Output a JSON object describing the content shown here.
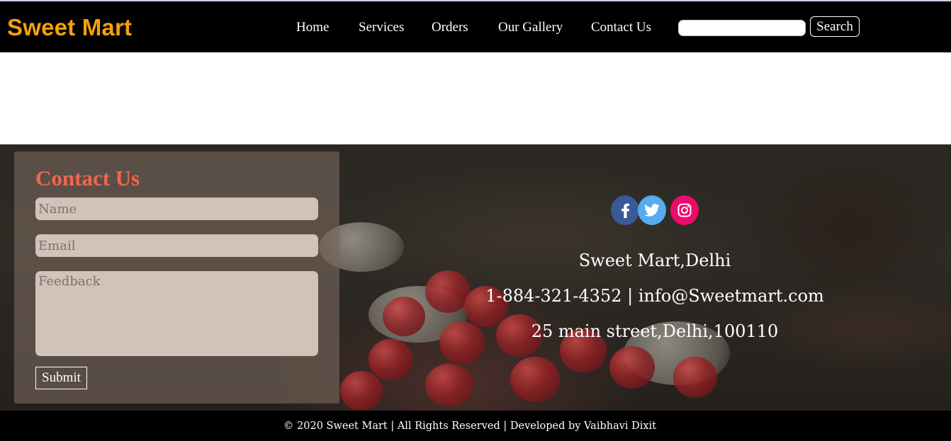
{
  "header": {
    "brand": "Sweet Mart",
    "nav": [
      {
        "label": "Home"
      },
      {
        "label": "Services"
      },
      {
        "label": "Orders"
      },
      {
        "label": "Our Gallery"
      },
      {
        "label": "Contact Us"
      }
    ],
    "search": {
      "value": "",
      "placeholder": "",
      "button_label": "Search"
    }
  },
  "contact_form": {
    "title": "Contact Us",
    "name_placeholder": "Name",
    "email_placeholder": "Email",
    "feedback_placeholder": "Feedback",
    "submit_label": "Submit"
  },
  "social": {
    "icons": [
      "facebook-icon",
      "twitter-icon",
      "instagram-icon"
    ],
    "colors": {
      "facebook": "#3b5998",
      "twitter": "#55acee",
      "instagram": "#ee0a6a"
    }
  },
  "info": {
    "name": "Sweet Mart,Delhi",
    "contact": "1-884-321-4352 | info@Sweetmart.com",
    "address": "25 main street,Delhi,100110"
  },
  "footer": {
    "copyright": "© 2020 Sweet Mart | All Rights Reserved | Developed by Vaibhavi Dixit"
  },
  "colors": {
    "brand": "#f5a00c",
    "contact_title": "#f0664d",
    "header_bg": "#000000"
  }
}
